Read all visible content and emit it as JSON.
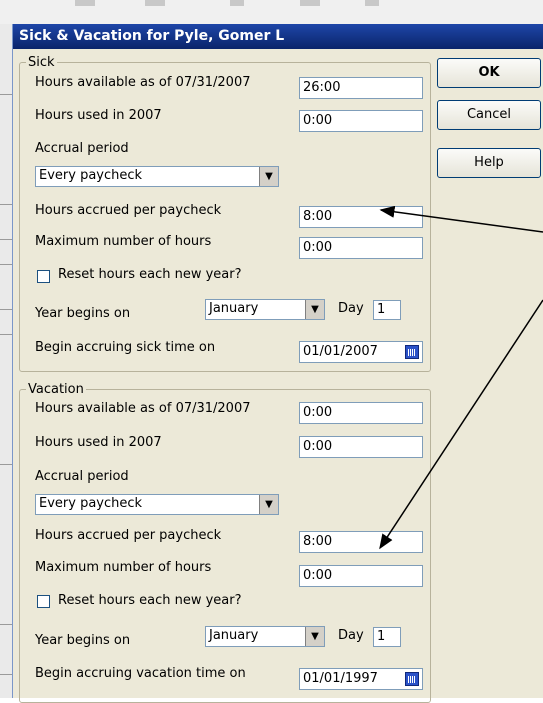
{
  "dialog": {
    "title": "Sick & Vacation for Pyle, Gomer L"
  },
  "buttons": {
    "ok": "OK",
    "cancel": "Cancel",
    "help": "Help"
  },
  "sick": {
    "legend": "Sick",
    "hours_available_label": "Hours available as of 07/31/2007",
    "hours_available_value": "26:00",
    "hours_used_label": "Hours used in 2007",
    "hours_used_value": "0:00",
    "accrual_period_label": "Accrual period",
    "accrual_period_value": "Every paycheck",
    "hours_accrued_label": "Hours accrued per paycheck",
    "hours_accrued_value": "8:00",
    "max_hours_label": "Maximum number of hours",
    "max_hours_value": "0:00",
    "reset_label": "Reset hours each new year?",
    "reset_checked": false,
    "year_begins_label": "Year begins on",
    "year_begins_month": "January",
    "day_label": "Day",
    "day_value": "1",
    "begin_accruing_label": "Begin accruing sick time on",
    "begin_accruing_value": "01/01/2007"
  },
  "vacation": {
    "legend": "Vacation",
    "hours_available_label": "Hours available as of 07/31/2007",
    "hours_available_value": "0:00",
    "hours_used_label": "Hours used in 2007",
    "hours_used_value": "0:00",
    "accrual_period_label": "Accrual period",
    "accrual_period_value": "Every paycheck",
    "hours_accrued_label": "Hours accrued per paycheck",
    "hours_accrued_value": "8:00",
    "max_hours_label": "Maximum number of hours",
    "max_hours_value": "0:00",
    "reset_label": "Reset hours each new year?",
    "reset_checked": false,
    "year_begins_label": "Year begins on",
    "year_begins_month": "January",
    "day_label": "Day",
    "day_value": "1",
    "begin_accruing_label": "Begin accruing vacation time on",
    "begin_accruing_value": "01/01/1997"
  },
  "colors": {
    "titlebar": "#0a246a",
    "dialog_bg": "#ece9d8",
    "annotation": "#000000"
  }
}
